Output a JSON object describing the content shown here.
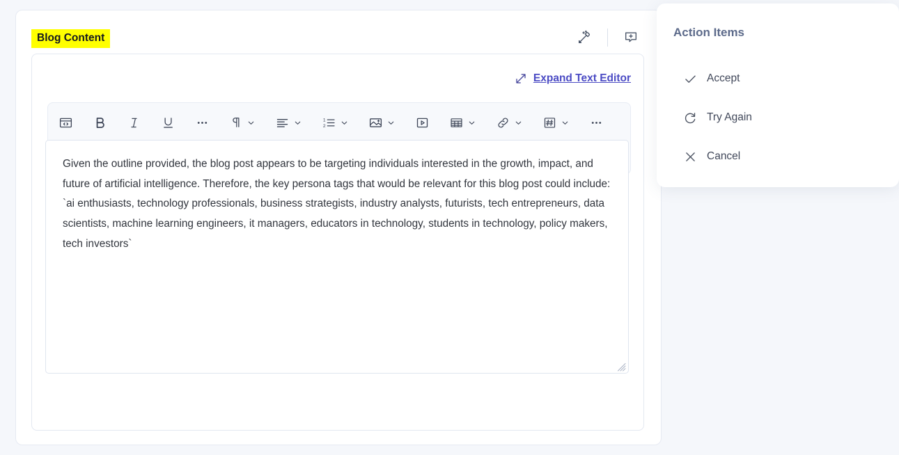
{
  "field": {
    "label": "Blog Content"
  },
  "header_icons": [
    {
      "name": "magic-wand-icon",
      "title": "AI Assist"
    },
    {
      "name": "add-comment-icon",
      "title": "Add Comment"
    }
  ],
  "editor": {
    "expand_label": "Expand Text Editor",
    "expand_icon": "expand-arrow-icon",
    "body_text": "Given the outline provided, the blog post appears to be targeting individuals interested in the growth, impact, and future of artificial intelligence. Therefore, the key persona tags that would be relevant for this blog post could include: `ai enthusiasts, technology professionals, business strategists, industry analysts, futurists, tech entrepreneurs, data scientists, machine learning engineers, it managers, educators in technology, students in technology, policy makers, tech investors`",
    "placeholder": ""
  },
  "toolbar": {
    "row1": [
      {
        "name": "code-block-button",
        "icon": "code-block-icon",
        "label": "",
        "chevron": false,
        "disabled": false
      },
      {
        "name": "bold-button",
        "icon": "bold-icon",
        "label": "B",
        "chevron": false,
        "disabled": false
      },
      {
        "name": "italic-button",
        "icon": "italic-icon",
        "label": "I",
        "chevron": false,
        "disabled": false
      },
      {
        "name": "underline-button",
        "icon": "underline-icon",
        "label": "U",
        "chevron": false,
        "disabled": false
      },
      {
        "name": "more-formats-button",
        "icon": "ellipsis-icon",
        "label": "",
        "chevron": false,
        "disabled": false
      },
      {
        "name": "paragraph-style-dropdown",
        "icon": "pilcrow-icon",
        "label": "",
        "chevron": true,
        "disabled": false
      },
      {
        "name": "align-dropdown",
        "icon": "align-left-icon",
        "label": "",
        "chevron": true,
        "disabled": false
      },
      {
        "name": "list-dropdown",
        "icon": "ordered-list-icon",
        "label": "",
        "chevron": true,
        "disabled": false
      },
      {
        "name": "image-dropdown",
        "icon": "image-icon",
        "label": "",
        "chevron": true,
        "disabled": false
      },
      {
        "name": "video-button",
        "icon": "video-icon",
        "label": "",
        "chevron": false,
        "disabled": false
      },
      {
        "name": "table-dropdown",
        "icon": "table-icon",
        "label": "",
        "chevron": true,
        "disabled": false
      },
      {
        "name": "link-dropdown",
        "icon": "link-icon",
        "label": "",
        "chevron": true,
        "disabled": false
      },
      {
        "name": "embed-dropdown",
        "icon": "hashtag-icon",
        "label": "",
        "chevron": true,
        "disabled": false
      },
      {
        "name": "more-tools-button",
        "icon": "ellipsis-icon",
        "label": "",
        "chevron": false,
        "disabled": false
      }
    ],
    "row2": [
      {
        "name": "undo-button",
        "icon": "undo-icon",
        "label": "",
        "chevron": false,
        "disabled": false
      },
      {
        "name": "redo-button",
        "icon": "redo-icon",
        "label": "",
        "chevron": false,
        "disabled": true
      }
    ]
  },
  "action_panel": {
    "title": "Action Items",
    "items": [
      {
        "name": "accept",
        "label": "Accept",
        "icon": "check-icon"
      },
      {
        "name": "try-again",
        "label": "Try Again",
        "icon": "refresh-icon"
      },
      {
        "name": "cancel",
        "label": "Cancel",
        "icon": "close-icon"
      }
    ]
  },
  "colors": {
    "page_background": "#f5f7fb",
    "highlight": "#ffff00",
    "link": "#4b4bc4",
    "panel_title": "#5c6a8a",
    "toolbar_background": "#f7f9fc"
  }
}
